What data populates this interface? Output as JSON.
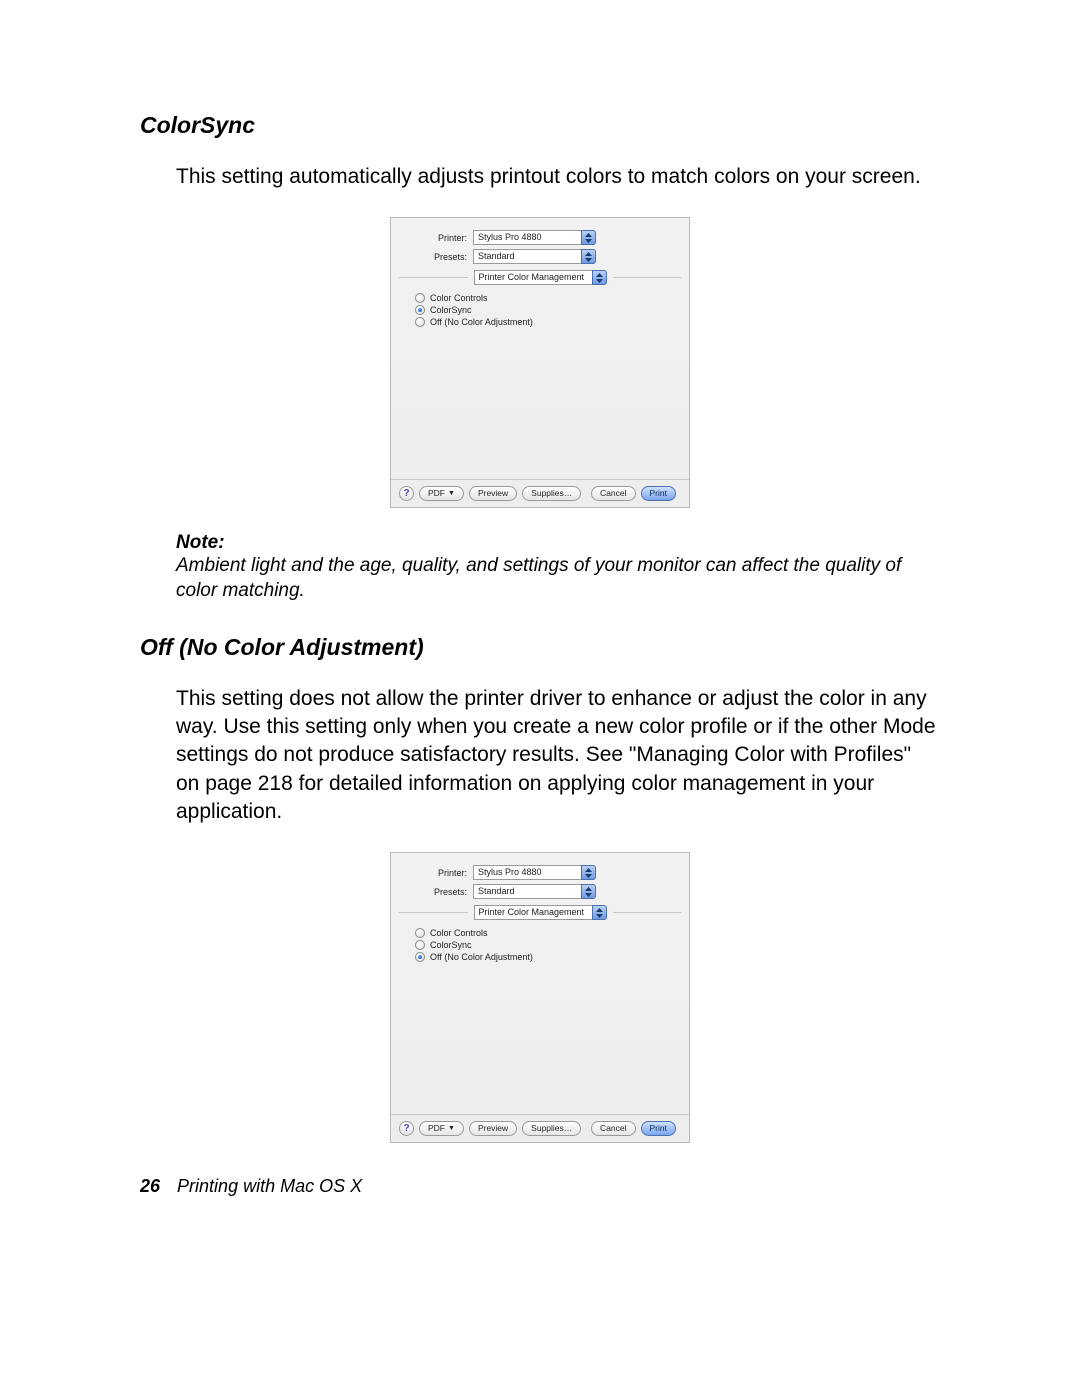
{
  "section1": {
    "heading": "ColorSync",
    "paragraph": "This setting automatically adjusts printout colors to match colors on your screen."
  },
  "note": {
    "label": "Note:",
    "text": "Ambient light and the age, quality, and settings of your monitor can affect the quality of color matching."
  },
  "section2": {
    "heading": "Off (No Color Adjustment)",
    "paragraph": "This setting does not allow the printer driver to enhance or adjust the color in any way. Use this setting only when you create a new color profile or if the other Mode settings do not produce satisfactory results. See \"Managing Color with Profiles\" on page 218 for detailed information on applying color management in your application."
  },
  "dialog": {
    "printer_label": "Printer:",
    "printer_value": "Stylus Pro 4880",
    "presets_label": "Presets:",
    "presets_value": "Standard",
    "pane_value": "Printer Color Management",
    "radios": {
      "color_controls": "Color Controls",
      "colorsync": "ColorSync",
      "off": "Off (No Color Adjustment)"
    },
    "buttons": {
      "help": "?",
      "pdf": "PDF",
      "preview": "Preview",
      "supplies": "Supplies…",
      "cancel": "Cancel",
      "print": "Print"
    }
  },
  "footer": {
    "page_number": "26",
    "title": "Printing with Mac OS X"
  }
}
